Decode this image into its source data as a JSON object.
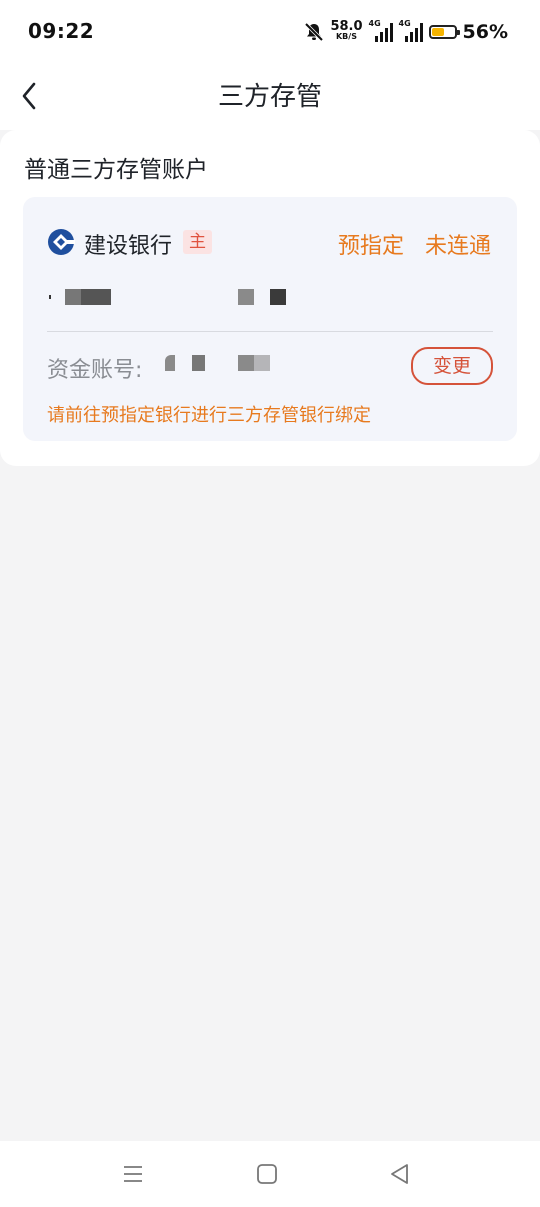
{
  "status_bar": {
    "time": "09:22",
    "net_speed_value": "58.0",
    "net_speed_unit": "KB/S",
    "sim1_tag": "4G",
    "sim2_tag": "4G",
    "battery_percent": "56%",
    "battery_level": 0.56,
    "battery_color": "#f5b400"
  },
  "header": {
    "title": "三方存管"
  },
  "account_section": {
    "title": "普通三方存管账户",
    "bank_name": "建设银行",
    "primary_badge": "主",
    "status_designation": "预指定",
    "status_connection": "未连通",
    "fund_account_label": "资金账号:",
    "change_button": "变更",
    "hint": "请前往预指定银行进行三方存管银行绑定"
  },
  "colors": {
    "accent_orange": "#e77a1f",
    "change_red": "#d5533a",
    "bank_logo_blue": "#1f4f9e"
  },
  "icons": {
    "back": "back-arrow-icon",
    "bank_logo": "ccb-bank-logo-icon",
    "mute": "bell-mute-icon",
    "nav_menu": "menu-icon",
    "nav_home": "home-square-icon",
    "nav_back": "back-triangle-icon"
  }
}
